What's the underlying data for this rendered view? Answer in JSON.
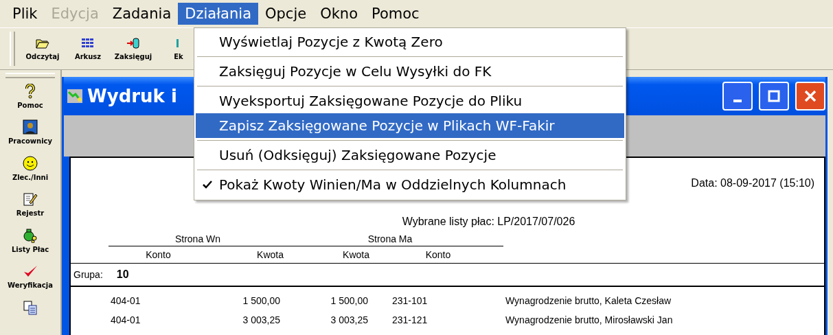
{
  "menu_bar": [
    {
      "label": "Plik",
      "disabled": false,
      "selected": false
    },
    {
      "label": "Edycja",
      "disabled": true,
      "selected": false
    },
    {
      "label": "Zadania",
      "disabled": false,
      "selected": false
    },
    {
      "label": "Działania",
      "disabled": false,
      "selected": true
    },
    {
      "label": "Opcje",
      "disabled": false,
      "selected": false
    },
    {
      "label": "Okno",
      "disabled": false,
      "selected": false
    },
    {
      "label": "Pomoc",
      "disabled": false,
      "selected": false
    }
  ],
  "dropdown_menu": [
    {
      "kind": "item",
      "label": "Wyświetlaj Pozycje z Kwotą Zero",
      "checked": false,
      "selected": false
    },
    {
      "kind": "separator"
    },
    {
      "kind": "item",
      "label": "Zaksięguj Pozycje w Celu Wysyłki do FK",
      "checked": false,
      "selected": false
    },
    {
      "kind": "separator"
    },
    {
      "kind": "item",
      "label": "Wyeksportuj Zaksięgowane Pozycje do Pliku",
      "checked": false,
      "selected": false
    },
    {
      "kind": "item",
      "label": "Zapisz Zaksięgowane Pozycje w Plikach WF-Fakir",
      "checked": false,
      "selected": true
    },
    {
      "kind": "separator"
    },
    {
      "kind": "item",
      "label": "Usuń (Odksięguj) Zaksięgowane Pozycje",
      "checked": false,
      "selected": false
    },
    {
      "kind": "separator"
    },
    {
      "kind": "item",
      "label": "Pokaż Kwoty Winien/Ma w Oddzielnych Kolumnach",
      "checked": true,
      "selected": false
    }
  ],
  "toolbar": [
    {
      "kind": "open",
      "label": "Odczytaj"
    },
    {
      "kind": "sheet",
      "label": "Arkusz"
    },
    {
      "kind": "post",
      "label": "Zaksięguj"
    },
    {
      "kind": "export",
      "label": "Ek"
    }
  ],
  "sidebar": [
    {
      "kind": "help",
      "label": "Pomoc"
    },
    {
      "kind": "person",
      "label": "Pracownicy"
    },
    {
      "kind": "smiley",
      "label": "Zlec./Inni"
    },
    {
      "kind": "register",
      "label": "Rejestr"
    },
    {
      "kind": "money",
      "label": "Listy Płac"
    },
    {
      "kind": "check",
      "label": "Weryfikacja"
    },
    {
      "kind": "copy"
    }
  ],
  "window": {
    "title": "Wydruk i"
  },
  "report": {
    "date": "Data:  08-09-2017 (15:10)",
    "subtitle": "Wybrane listy płac: LP/2017/07/026",
    "group_headers": [
      "Strona Wn",
      "Strona Ma"
    ],
    "columns": [
      "Konto",
      "Kwota",
      "Kwota",
      "Konto"
    ],
    "group_label": "Grupa:",
    "group_value": "10",
    "rows": [
      [
        "404-01",
        "1 500,00",
        "1 500,00",
        "231-101",
        "Wynagrodzenie brutto, Kaleta Czesław"
      ],
      [
        "404-01",
        "3 003,25",
        "3 003,25",
        "231-121",
        "Wynagrodzenie brutto, Mirosławski Jan"
      ]
    ]
  }
}
